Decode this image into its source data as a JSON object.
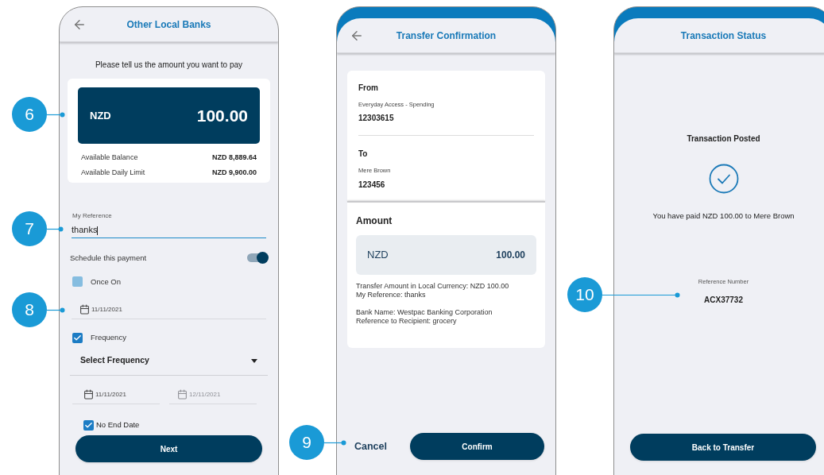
{
  "screens": [
    {
      "kind": "amount_entry",
      "title": "Other Local Banks",
      "prompt": "Please tell us the amount you want to pay",
      "currency": "NZD",
      "amount": "100.00",
      "balances": [
        {
          "label": "Available Balance",
          "value": "NZD 8,889.64"
        },
        {
          "label": "Available Daily Limit",
          "value": "NZD 9,900.00"
        }
      ],
      "reference": {
        "label": "My Reference",
        "value": "thanks"
      },
      "schedule": {
        "label": "Schedule this payment",
        "on": true
      },
      "once": {
        "label": "Once On",
        "checked": false
      },
      "once_date": {
        "value": "11/11/2021",
        "disabled": false
      },
      "frequency": {
        "label": "Frequency",
        "checked": true
      },
      "frequency_select": "Select Frequency",
      "start_date": {
        "value": "11/11/2021",
        "disabled": false
      },
      "end_date": {
        "value": "12/11/2021",
        "disabled": true
      },
      "no_end_date": {
        "label": "No End Date",
        "checked": true
      },
      "button": "Next"
    },
    {
      "kind": "confirmation",
      "title": "Transfer Confirmation",
      "from": {
        "heading": "From",
        "account": "Everyday Access - Spending",
        "number": "12303615"
      },
      "to": {
        "heading": "To",
        "account": "Mere Brown",
        "number": "123456"
      },
      "amount_heading": "Amount",
      "currency": "NZD",
      "amount": "100.00",
      "details": [
        "Transfer Amount in Local Currency: NZD 100.00",
        "My Reference: thanks",
        "Bank Name: Westpac Banking Corporation",
        "Reference to Recipient: grocery"
      ],
      "cancel": "Cancel",
      "button": "Confirm"
    },
    {
      "kind": "status",
      "title": "Transaction Status",
      "status": "Transaction Posted",
      "message": "You have paid NZD 100.00 to Mere Brown",
      "reference_label": "Reference Number",
      "reference_number": "ACX37732",
      "button": "Back to Transfer"
    }
  ],
  "callouts": [
    {
      "number": "6"
    },
    {
      "number": "7"
    },
    {
      "number": "8"
    },
    {
      "number": "9"
    },
    {
      "number": "10"
    }
  ]
}
